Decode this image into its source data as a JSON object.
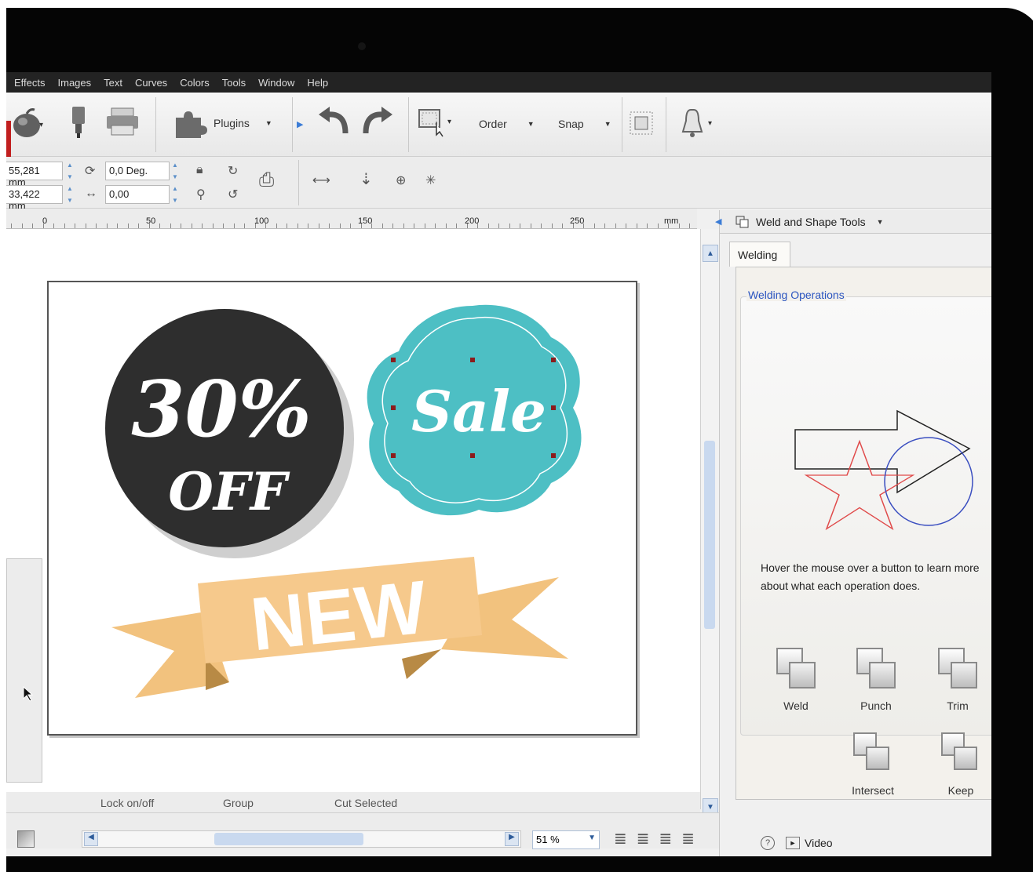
{
  "menu": [
    "Effects",
    "Images",
    "Text",
    "Curves",
    "Colors",
    "Tools",
    "Window",
    "Help"
  ],
  "toolbar": {
    "plugins_label": "Plugins",
    "order_label": "Order",
    "snap_label": "Snap"
  },
  "transform": {
    "x_value": "55,281 mm",
    "y_value": "33,422 mm",
    "rotation_value": "0,0 Deg.",
    "shear_value": "0,00"
  },
  "ruler": {
    "ticks": [
      "0",
      "50",
      "100",
      "150",
      "200",
      "250"
    ],
    "unit": "mm"
  },
  "artwork": {
    "badge_line1": "30%",
    "badge_line2": "OFF",
    "sale_text": "Sale",
    "ribbon_text": "NEW",
    "colors": {
      "badge": "#2e2e2e",
      "sale": "#4dbfc4",
      "ribbon": "#f4c889",
      "ribbon_dark": "#d9a85c"
    }
  },
  "status": {
    "lock": "Lock on/off",
    "group": "Group",
    "cut": "Cut Selected"
  },
  "zoom": "51 %",
  "panel": {
    "title": "Weld and Shape Tools",
    "tab": "Welding",
    "group_title": "Welding Operations",
    "hint": "Hover the mouse over a button to learn more about what each operation does.",
    "ops": [
      "Weld",
      "Punch",
      "Trim",
      "Intersect",
      "Keep"
    ],
    "video_label": "Video"
  }
}
